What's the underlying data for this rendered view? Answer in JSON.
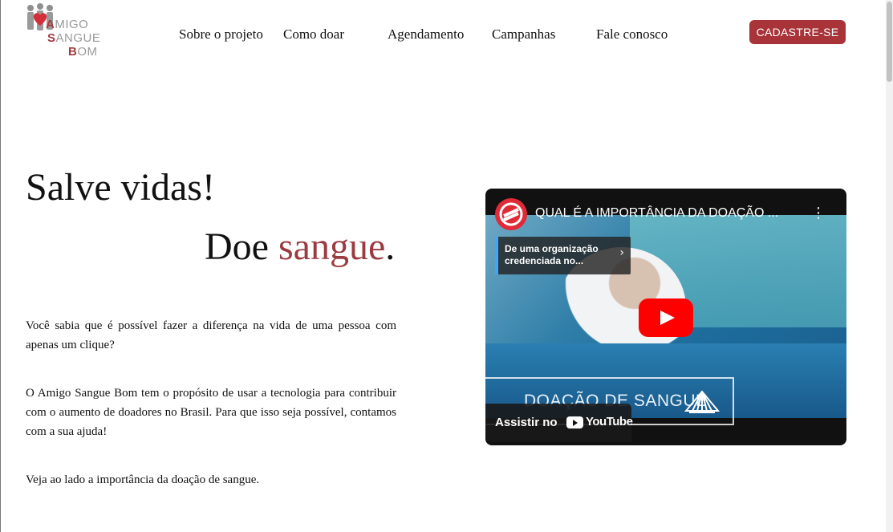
{
  "header": {
    "logo": {
      "line1_first": "A",
      "line1_rest": "MIGO",
      "line2_first": "S",
      "line2_rest": "ANGUE",
      "line3_first": "B",
      "line3_rest": "OM"
    },
    "nav": [
      "Sobre o projeto",
      "Como doar",
      "Agendamento",
      "Campanhas",
      "Fale conosco"
    ],
    "cta_label": "CADASTRE-SE"
  },
  "hero": {
    "title": "Salve vidas!",
    "subtitle_prefix": "Doe ",
    "subtitle_accent": "sangue",
    "subtitle_suffix": ".",
    "paragraphs": [
      "Você sabia que é possível fazer a diferença na vida de uma pessoa com apenas um clique?",
      "O Amigo Sangue Bom tem o propósito de usar a tecnologia para contribuir com o aumento de doadores no Brasil. Para que isso seja possível, contamos com a sua ajuda!",
      "Veja ao lado a importância da doação de sangue."
    ]
  },
  "video": {
    "title": "QUAL É A IMPORTÂNCIA DA DOAÇÃO ...",
    "info_panel": "De uma organização credenciada no...",
    "overlay_text": "DOAÇÃO DE SANGUE",
    "watch_label": "Assistir no",
    "youtube_label": "YouTube"
  },
  "colors": {
    "accent": "#a8343a",
    "link_accent": "#9b3b40"
  }
}
